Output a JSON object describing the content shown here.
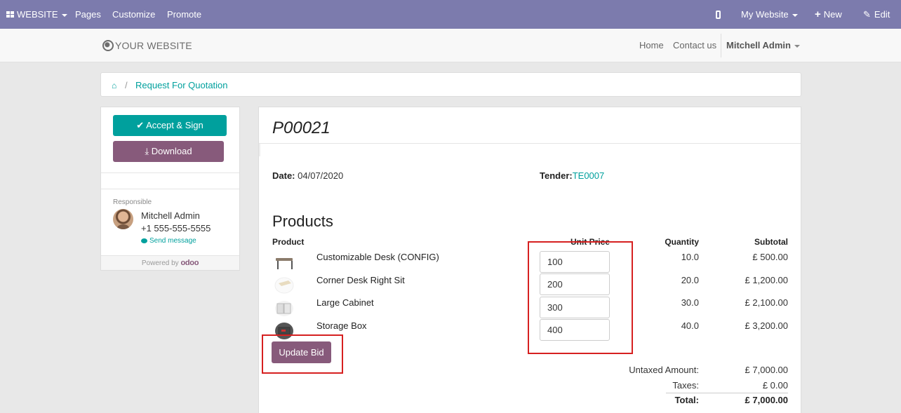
{
  "admin_bar": {
    "app_menu": "WEBSITE",
    "pages": "Pages",
    "customize": "Customize",
    "promote": "Promote",
    "my_website": "My Website",
    "new": "New",
    "edit": "Edit",
    "bg_color": "#7c7bad"
  },
  "header": {
    "logo_text": "YOUR WEBSITE",
    "nav": {
      "home": "Home",
      "contact": "Contact us",
      "user": "Mitchell Admin"
    }
  },
  "breadcrumb": {
    "separator": "/",
    "current": "Request For Quotation"
  },
  "sidebar": {
    "accept_label": "Accept & Sign",
    "download_label": "Download",
    "responsible_label": "Responsible",
    "responsible_name": "Mitchell Admin",
    "responsible_phone": "+1 555-555-5555",
    "send_message": "Send message",
    "powered_by": "Powered by",
    "powered_brand": "odoo"
  },
  "document": {
    "title": "P00021",
    "date_label": "Date:",
    "date_value": "04/07/2020",
    "tender_label": "Tender:",
    "tender_value": "TE0007",
    "products_heading": "Products",
    "columns": {
      "product": "Product",
      "unit_price": "Unit Price",
      "quantity": "Quantity",
      "subtotal": "Subtotal"
    },
    "lines": [
      {
        "product": "Customizable Desk (CONFIG)",
        "unit_price": "100",
        "quantity": "10.0",
        "subtotal": "£ 500.00",
        "image": "desk-icon"
      },
      {
        "product": "Corner Desk Right Sit",
        "unit_price": "200",
        "quantity": "20.0",
        "subtotal": "£ 1,200.00",
        "image": "corner-desk-icon"
      },
      {
        "product": "Large Cabinet",
        "unit_price": "300",
        "quantity": "30.0",
        "subtotal": "£ 2,100.00",
        "image": "cabinet-icon"
      },
      {
        "product": "Storage Box",
        "unit_price": "400",
        "quantity": "40.0",
        "subtotal": "£ 3,200.00",
        "image": "storage-box-icon"
      }
    ],
    "update_bid_label": "Update Bid",
    "totals": {
      "untaxed_label": "Untaxed Amount:",
      "untaxed_value": "£ 7,000.00",
      "taxes_label": "Taxes:",
      "taxes_value": "£ 0.00",
      "total_label": "Total:",
      "total_value": "£ 7,000.00"
    }
  },
  "colors": {
    "primary": "#00a09d",
    "secondary": "#875a7b",
    "highlight": "#d62020"
  }
}
